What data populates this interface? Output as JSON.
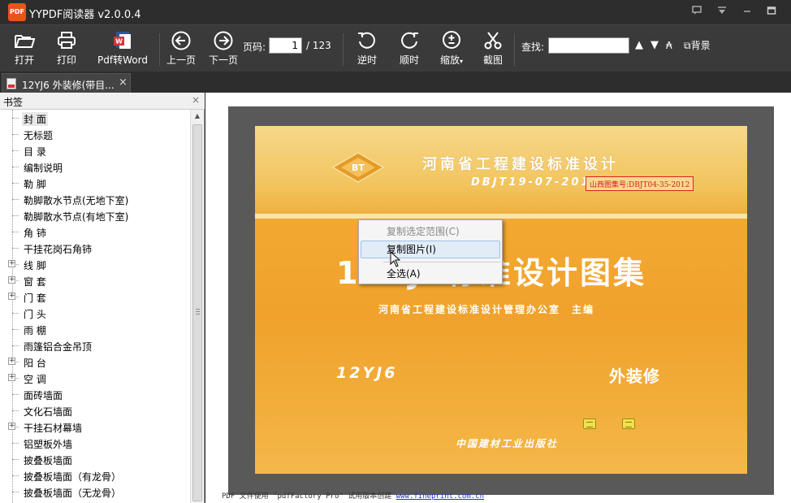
{
  "window": {
    "logo_text": "PDF",
    "title": "YYPDF阅读器 v2.0.0.4"
  },
  "toolbar": {
    "open": "打开",
    "print": "打印",
    "pdf_to_word": "Pdf转Word",
    "prev_page": "上一页",
    "next_page": "下一页",
    "page_label": "页码:",
    "page_current": "1",
    "page_total": "/ 123",
    "rotate_ccw": "逆时",
    "rotate_cw": "顺时",
    "zoom": "缩放",
    "screenshot": "截图",
    "find_label": "查找:",
    "find_value": "",
    "background": "背景"
  },
  "tab": {
    "label": "12YJ6 外装修(带目...",
    "close": "×"
  },
  "sidebar": {
    "title": "书签",
    "close": "×",
    "items": [
      {
        "label": "封 面",
        "expandable": false,
        "selected": true
      },
      {
        "label": "无标题",
        "expandable": false,
        "selected": false
      },
      {
        "label": "目 录",
        "expandable": false,
        "selected": false
      },
      {
        "label": "编制说明",
        "expandable": false,
        "selected": false
      },
      {
        "label": "勒 脚",
        "expandable": false,
        "selected": false
      },
      {
        "label": "勒脚散水节点(无地下室)",
        "expandable": false,
        "selected": false
      },
      {
        "label": "勒脚散水节点(有地下室)",
        "expandable": false,
        "selected": false
      },
      {
        "label": "角 铈",
        "expandable": false,
        "selected": false
      },
      {
        "label": "干挂花岗石角铈",
        "expandable": false,
        "selected": false
      },
      {
        "label": "线 脚",
        "expandable": true,
        "selected": false
      },
      {
        "label": "窗 套",
        "expandable": true,
        "selected": false
      },
      {
        "label": "门 套",
        "expandable": true,
        "selected": false
      },
      {
        "label": "门 头",
        "expandable": false,
        "selected": false
      },
      {
        "label": "雨 棚",
        "expandable": false,
        "selected": false
      },
      {
        "label": "雨篷铝合金吊顶",
        "expandable": false,
        "selected": false
      },
      {
        "label": "阳 台",
        "expandable": true,
        "selected": false
      },
      {
        "label": "空 调",
        "expandable": true,
        "selected": false
      },
      {
        "label": "面砖墙面",
        "expandable": false,
        "selected": false
      },
      {
        "label": "文化石墙面",
        "expandable": false,
        "selected": false
      },
      {
        "label": "干挂石材幕墙",
        "expandable": true,
        "selected": false
      },
      {
        "label": "铝塑板外墙",
        "expandable": false,
        "selected": false
      },
      {
        "label": "披叠板墙面",
        "expandable": false,
        "selected": false
      },
      {
        "label": "披叠板墙面（有龙骨）",
        "expandable": false,
        "selected": false
      },
      {
        "label": "披叠板墙面（无龙骨）",
        "expandable": false,
        "selected": false
      }
    ]
  },
  "cover": {
    "logo_text": "BT",
    "org": "河南省工程建设标准设计",
    "code": "DBJT19-07-2012",
    "shanxi_code": "山西图集号:DBJT04-35-2012",
    "title": "12YJ6标准设计图集",
    "editor": "河南省工程建设标准设计管理办公室　主编",
    "number": "12YJ6",
    "subject": "外装修",
    "publisher": "中国建材工业出版社"
  },
  "footer": {
    "text": "PDF 文件使用 \"pdfFactory Pro\" 试用版本创建 ",
    "link": "www.fineprint.com.cn"
  },
  "context_menu": {
    "items": [
      {
        "label": "复制选定范围(C)",
        "enabled": false
      },
      {
        "label": "复制图片(I)",
        "enabled": true,
        "hover": true
      },
      {
        "label": "全选(A)",
        "enabled": true
      }
    ]
  },
  "colors": {
    "titlebar_bg": "#2d2d2d",
    "toolbar_bg": "#3a3a3a",
    "cover_orange": "#f0a22c",
    "logo_orange": "#e8541e"
  }
}
